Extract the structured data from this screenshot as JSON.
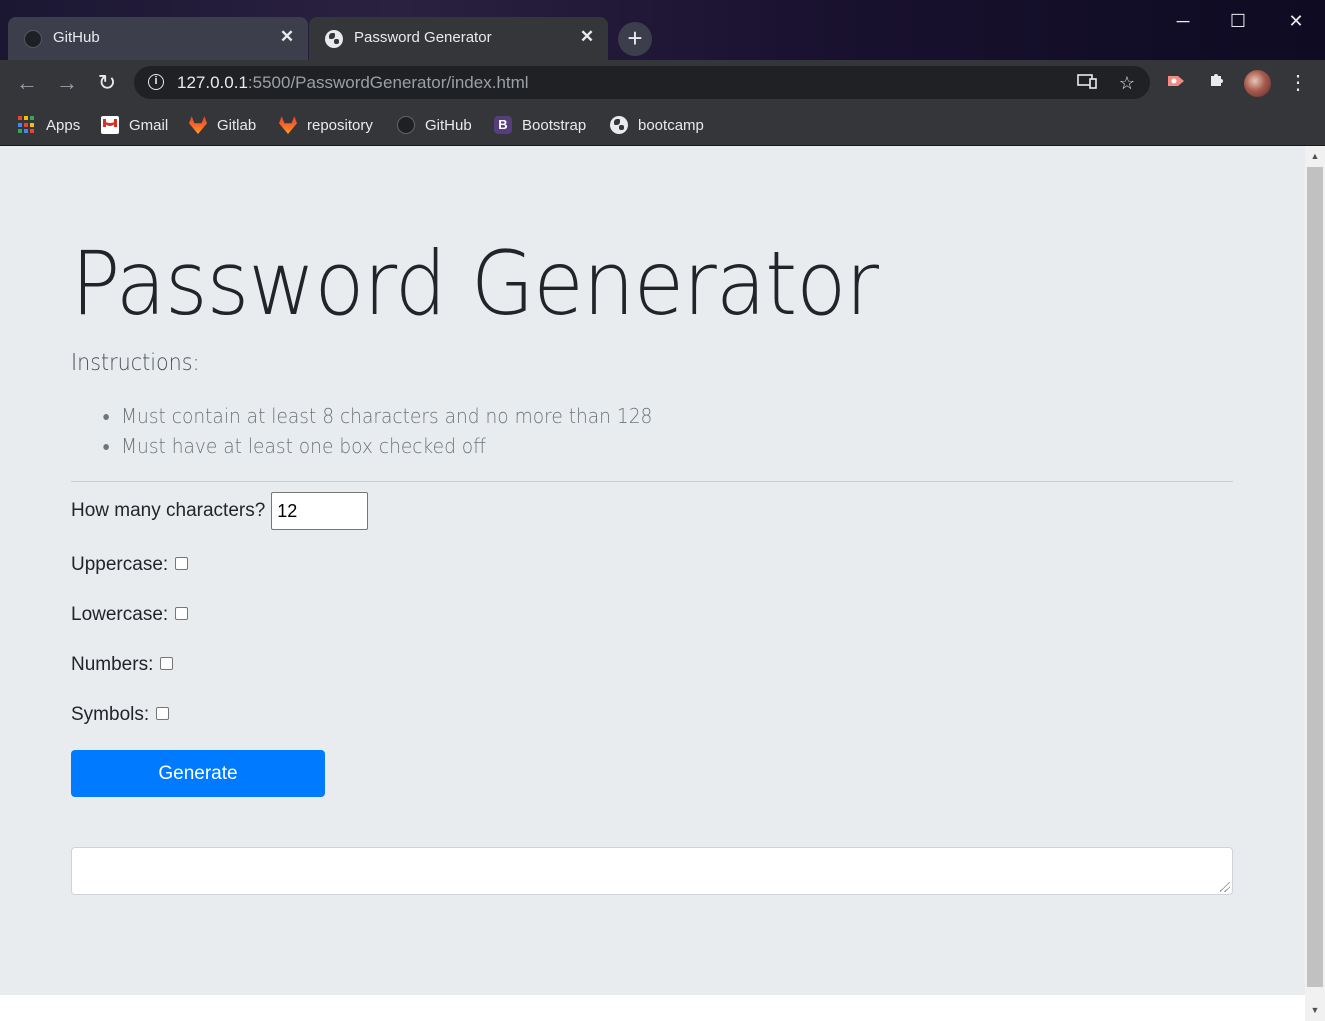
{
  "browser": {
    "tabs": [
      {
        "title": "GitHub",
        "active": false,
        "favicon": "github-icon"
      },
      {
        "title": "Password Generator",
        "active": true,
        "favicon": "globe-icon"
      }
    ],
    "new_tab_symbol": "+",
    "window_controls": {
      "minimize": "─",
      "maximize": "☐",
      "close": "✕"
    },
    "nav": {
      "back": "←",
      "forward": "→",
      "reload": "↻"
    },
    "url": {
      "host": "127.0.0.1",
      "rest": ":5500/PasswordGenerator/index.html"
    },
    "bookmarks": [
      {
        "label": "Apps",
        "icon": "apps-grid-icon"
      },
      {
        "label": "Gmail",
        "icon": "gmail-icon"
      },
      {
        "label": "Gitlab",
        "icon": "gitlab-icon"
      },
      {
        "label": "repository",
        "icon": "gitlab-icon"
      },
      {
        "label": "GitHub",
        "icon": "github-icon"
      },
      {
        "label": "Bootstrap",
        "icon": "bootstrap-icon",
        "glyph": "B"
      },
      {
        "label": "bootcamp",
        "icon": "globe-icon"
      }
    ],
    "colors": {
      "chrome_dark": "#35363a",
      "omnibox": "#202124"
    }
  },
  "page": {
    "title": "Password Generator",
    "instructions_heading": "Instructions:",
    "instructions": [
      "Must contain at least 8 characters and no more than 128",
      "Must have at least one box checked off"
    ],
    "length_label": "How many characters?",
    "length_value": "12",
    "options": [
      {
        "label": "Uppercase:",
        "checked": false
      },
      {
        "label": "Lowercase:",
        "checked": false
      },
      {
        "label": "Numbers:",
        "checked": false
      },
      {
        "label": "Symbols:",
        "checked": false
      }
    ],
    "generate_label": "Generate",
    "output_value": "",
    "colors": {
      "background": "#e9ecef",
      "primary": "#007bff",
      "text": "#212529",
      "muted": "#6c757d"
    }
  }
}
